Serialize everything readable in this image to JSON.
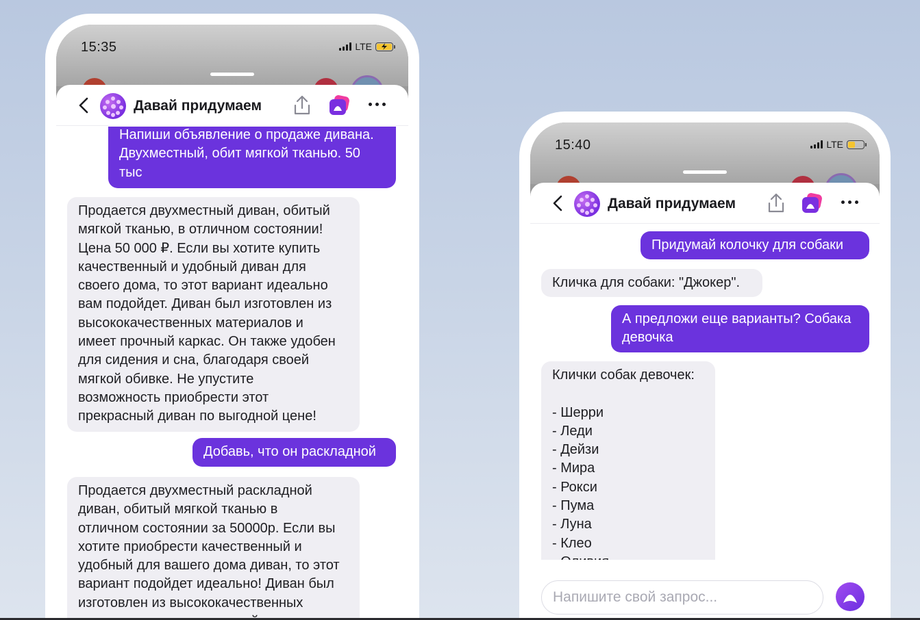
{
  "colors": {
    "user_bubble": "#6b33dd",
    "bot_bubble": "#efeef3",
    "accent": "#8a3ff0",
    "battery_left": "#f4c430",
    "battery_right": "#f4c430"
  },
  "left_phone": {
    "status": {
      "time": "15:35",
      "network": "LTE",
      "battery_icon": "battery-charging-icon"
    },
    "header": {
      "back_icon": "chevron-left-icon",
      "avatar_icon": "dots-avatar-icon",
      "title": "Давай придумаем",
      "share_icon": "share-icon",
      "alice_icon": "alice-icon",
      "more_icon": "more-dots-icon"
    },
    "messages": [
      {
        "role": "user",
        "text": "Напиши объявление о продаже дивана.\nДвухместный, обит мягкой тканью. 50\nтыс"
      },
      {
        "role": "bot",
        "text": "Продается двухместный диван, обитый\nмягкой тканью, в отличном состоянии!\nЦена 50 000 ₽. Если вы хотите купить\nкачественный и удобный диван для\nсвоего дома, то этот вариант идеально\nвам подойдет. Диван был изготовлен из\nвысококачественных материалов и\nимеет прочный каркас. Он также удобен\nдля сидения и сна, благодаря своей\nмягкой обивке. Не упустите\nвозможность приобрести этот\nпрекрасный диван по выгодной цене!"
      },
      {
        "role": "user",
        "text": "Добавь, что он раскладной"
      },
      {
        "role": "bot",
        "text": "Продается двухместный раскладной\nдиван, обитый мягкой тканью в\nотличном состоянии за 50000р. Если вы\nхотите приобрести качественный и\nудобный для вашего дома диван, то этот\nвариант подойдет идеально! Диван был\nизготовлен из высококачественных\nматериалов, имеет прочный каркас и"
      }
    ]
  },
  "right_phone": {
    "status": {
      "time": "15:40",
      "network": "LTE",
      "battery_icon": "battery-icon"
    },
    "header": {
      "back_icon": "chevron-left-icon",
      "avatar_icon": "dots-avatar-icon",
      "title": "Давай придумаем",
      "share_icon": "share-icon",
      "alice_icon": "alice-icon",
      "more_icon": "more-dots-icon"
    },
    "messages": [
      {
        "role": "user",
        "text": "Придумай колочку для собаки"
      },
      {
        "role": "bot",
        "text": "Кличка для собаки: \"Джокер\"."
      },
      {
        "role": "user",
        "text": "А предложи еще варианты? Собака\nдевочка"
      },
      {
        "role": "bot",
        "text": "Клички собак девочек:\n\n- Шерри\n- Леди\n- Дейзи\n- Мира\n- Рокси\n- Пума\n- Луна\n- Клео\n- Оливия"
      }
    ],
    "input": {
      "placeholder": "Напишите свой запрос...",
      "value": ""
    },
    "send_icon": "alice-send-icon"
  }
}
